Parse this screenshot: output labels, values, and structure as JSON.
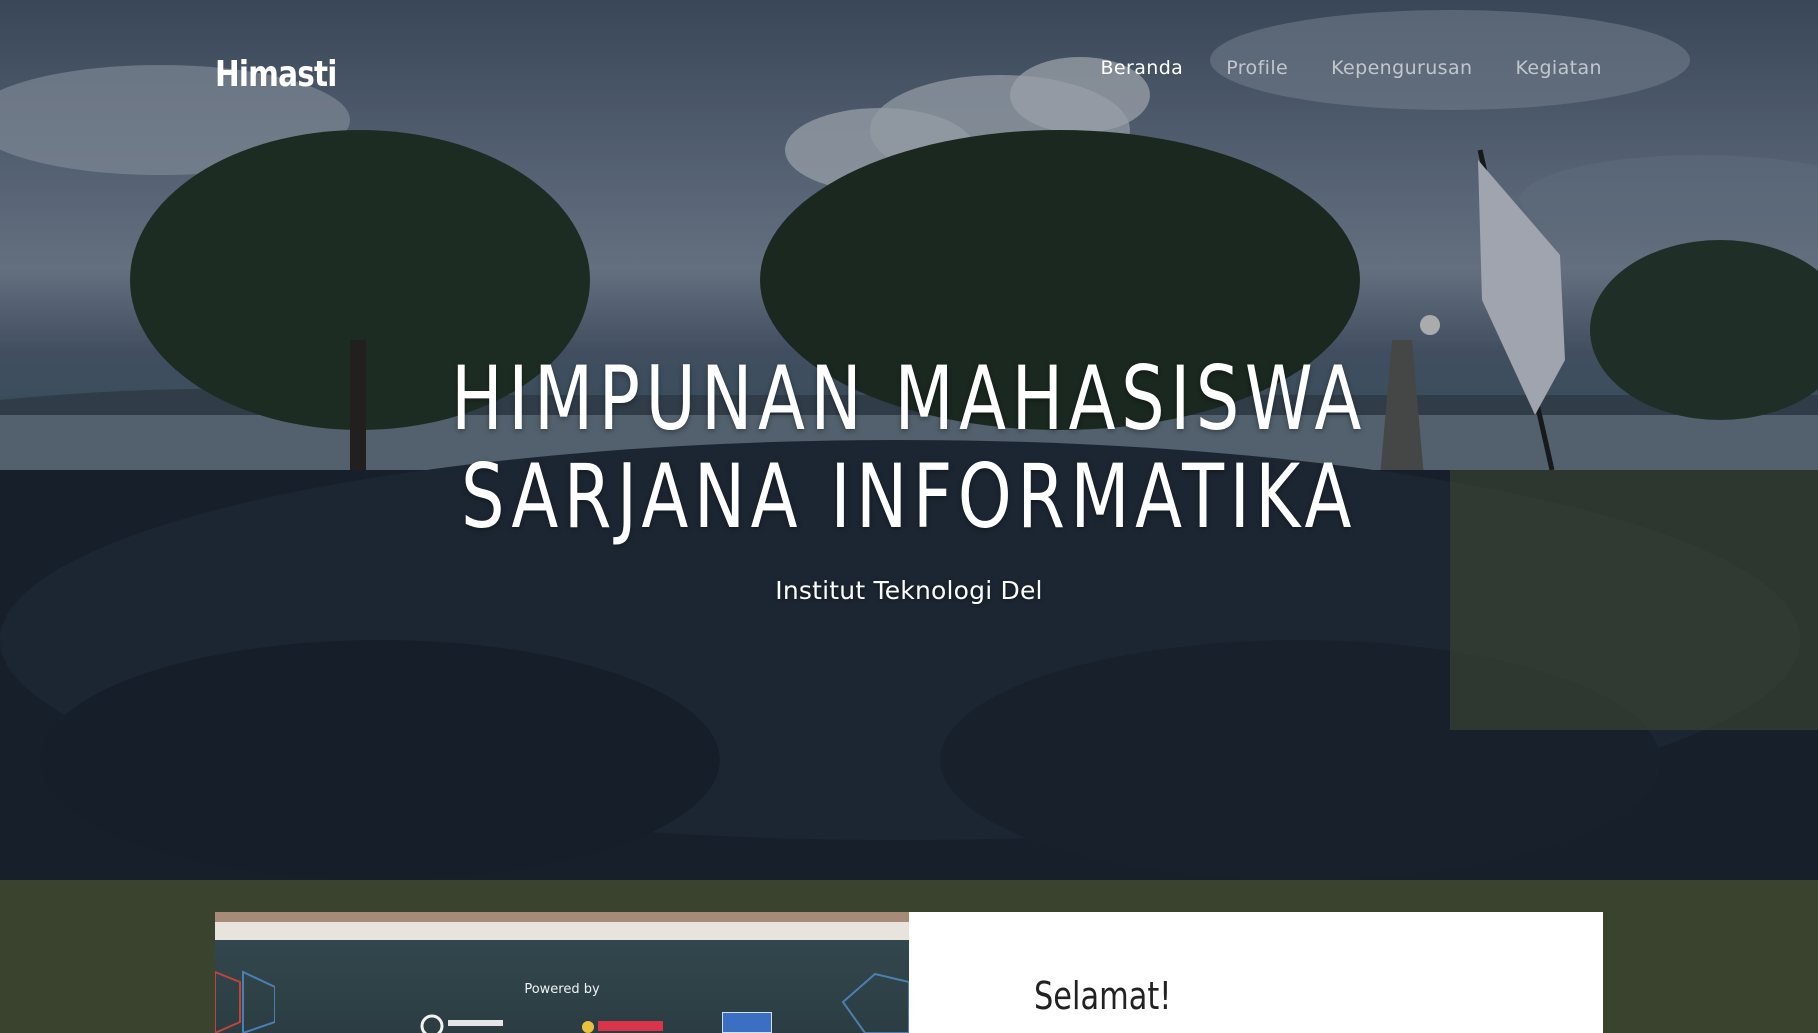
{
  "nav": {
    "brand": "Himasti",
    "items": [
      {
        "label": "Beranda",
        "active": true
      },
      {
        "label": "Profile",
        "active": false
      },
      {
        "label": "Kepengurusan",
        "active": false
      },
      {
        "label": "Kegiatan",
        "active": false
      }
    ]
  },
  "hero": {
    "title_line1": "HIMPUNAN MAHASISWA",
    "title_line2": "SARJANA INFORMATIKA",
    "subtitle": "Institut Teknologi Del"
  },
  "about": {
    "image_caption": "Powered by",
    "heading": "Selamat!"
  },
  "colors": {
    "nav_active": "#ffffff",
    "nav_inactive": "#b8bcc2",
    "card_background": "#ffffff"
  }
}
